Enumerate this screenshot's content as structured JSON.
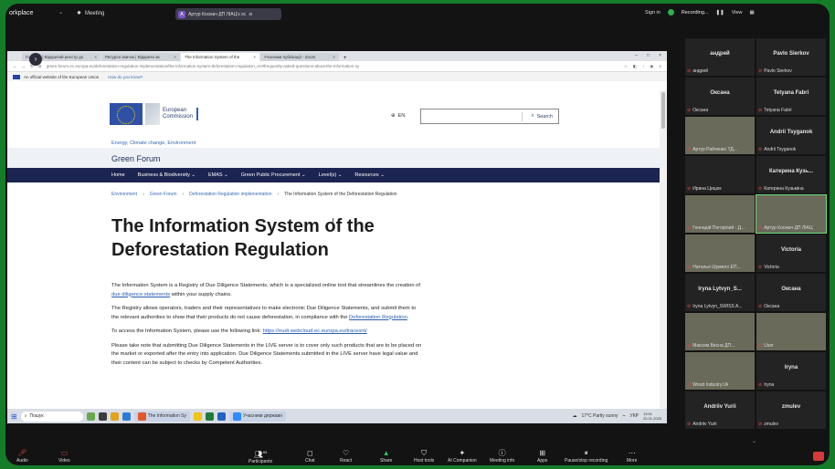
{
  "zoom": {
    "workspace": "orkplace",
    "meeting_label": "Meeting",
    "share_label": "Артур Космач ДП ЛІАЦ's sc",
    "share_avatar": "A",
    "signin": "Sign in",
    "recording": "Recording...",
    "view": "View"
  },
  "browser": {
    "tabs": [
      {
        "label": "Головна | Відкритий реєстр до"
      },
      {
        "label": "Ресурси звичок | Відкрити зв"
      },
      {
        "label": "The Information System of the"
      },
      {
        "label": "Учасники публікації - Zoom"
      }
    ],
    "url": "green-forum.ec.europa.eu/deforestation-regulation-implementation/the-information-system-deforestation-regulation_en#frequently-asked-questions-about-the-information-sy",
    "eu_notice": "An official website of the European Union",
    "eu_how": "How do you know?"
  },
  "site": {
    "logo_line1": "European",
    "logo_line2": "Commission",
    "lang": "EN",
    "search_label": "Search",
    "keywords": "Energy, Climate change, Environment",
    "site_title": "Green Forum",
    "nav": [
      "Home",
      "Business & Biodiversity ⌄",
      "EMAS ⌄",
      "Green Public Procurement ⌄",
      "Level(s) ⌄",
      "Resources ⌄"
    ],
    "breadcrumb": [
      "Environment",
      "Green Forum",
      "Deforestation Regulation implementation",
      "The Information System of the Deforestation Regulation"
    ],
    "title": "The Information System of the Deforestation Regulation",
    "p1_a": "The Information System is a Registry of Due Diligence Statements, which is a specialized online tool that streamlines the creation of ",
    "p1_link": "due diligence statements",
    "p1_b": " within your supply chains.",
    "p2_a": "The Registry allows operators, traders and their representatives to make electronic Due Diligence Statements, and submit them to the relevant authorities to show that their products do not cause deforestation, in compliance with the ",
    "p2_link": "Deforestation Regulation",
    "p2_b": ".",
    "p3_a": "To access the Information System, please use the following link: ",
    "p3_link": "https://eudr.webcloud.ec.europa.eu/tracesnt/",
    "p4": "Please take note that submitting Due Diligence Statements in the LIVE server is to cover only such products that are to be placed on the market or exported after the entry into application. Due Diligence Statements submitted in the LIVE server have legal value and their content can be subject to checks by Competent Authorities."
  },
  "taskbar": {
    "search": "Пошук",
    "item1": "The Information Sy",
    "item2": "Учасники державн",
    "weather": "17°C  Partly sunny",
    "lang": "УКР",
    "time": "13:51",
    "date": "20.01.2025"
  },
  "participants": [
    {
      "name": "андрей",
      "label": "андрей",
      "video": false
    },
    {
      "name": "Pavlo Sierkov",
      "label": "Pavlo Sierkov",
      "video": false
    },
    {
      "name": "Оксана",
      "label": "Оксана",
      "video": false
    },
    {
      "name": "Tetyana Fabri",
      "label": "Tetyana Fabri",
      "video": false
    },
    {
      "name": "",
      "label": "Артур Райченко ТД...",
      "video": true
    },
    {
      "name": "Andrii Tsyganok",
      "label": "Andrii Tsyganok",
      "video": false
    },
    {
      "name": "",
      "label": "Ирина Цицюк",
      "video": false
    },
    {
      "name": "Катерина Кузь...",
      "label": "Катерина Кузьміна",
      "video": false
    },
    {
      "name": "",
      "label": "Геннадій Погорілий - Д...",
      "video": true
    },
    {
      "name": "",
      "label": "Артур Космач ДП ЛІАЦ",
      "video": true,
      "active": true
    },
    {
      "name": "",
      "label": "Наталья Шумило ЕП...",
      "video": true
    },
    {
      "name": "Victoria",
      "label": "Victoria",
      "video": false
    },
    {
      "name": "Iryna Lytvyn_S...",
      "label": "Iryna Lytvyn_SWISS A...",
      "video": false
    },
    {
      "name": "Оксана",
      "label": "Оксана",
      "video": false
    },
    {
      "name": "",
      "label": "Максим Весна ДП...",
      "video": true
    },
    {
      "name": "",
      "label": "User",
      "video": true
    },
    {
      "name": "",
      "label": "Wood Industry.Uk",
      "video": true
    },
    {
      "name": "Iryna",
      "label": "Iryna",
      "video": false
    },
    {
      "name": "Andriiv Yurii",
      "label": "Andriiv Yurii",
      "video": false
    },
    {
      "name": "zmulev",
      "label": "zmulev",
      "video": false
    }
  ],
  "bottombar": {
    "audio": "Audio",
    "video": "Video",
    "participants": "Participants",
    "participants_count": "65",
    "chat": "Chat",
    "react": "React",
    "share": "Share",
    "host_tools": "Host tools",
    "ai": "AI Companion",
    "meeting_info": "Meeting info",
    "apps": "Apps",
    "pause": "Pause/stop recording",
    "more": "More"
  },
  "colors": {
    "frame": "#157c2a",
    "eu_blue": "#1c2452",
    "link": "#2a5cb3",
    "muted": "#e54848"
  }
}
